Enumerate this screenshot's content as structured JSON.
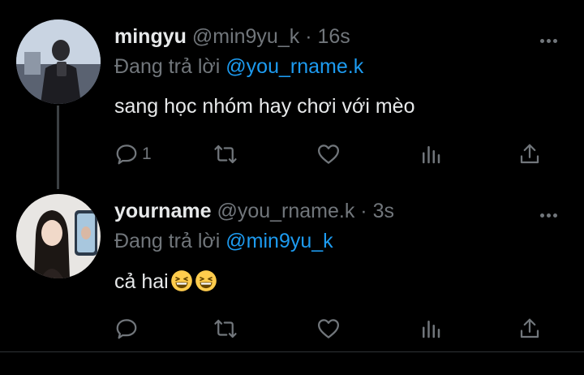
{
  "tweets": [
    {
      "name": "mingyu",
      "handle": "@min9yu_k",
      "time": "16s",
      "replying_prefix": "Đang trả lời",
      "replying_to": "@you_rname.k",
      "text": "sang học nhóm hay chơi với mèo",
      "reply_count": "1",
      "avatar": "man-mirror-selfie-photo"
    },
    {
      "name": "yourname",
      "handle": "@you_rname.k",
      "time": "3s",
      "replying_prefix": "Đang trả lời",
      "replying_to": "@min9yu_k",
      "text": "cả hai",
      "emoji": [
        "grinning-squinting-emoji",
        "grinning-squinting-emoji"
      ],
      "reply_count": "",
      "avatar": "woman-selfie-photo"
    }
  ],
  "icons": {
    "more": "more-dots-icon",
    "reply": "reply-bubble-icon",
    "retweet": "retweet-icon",
    "like": "heart-icon",
    "views": "views-chart-icon",
    "share": "share-icon"
  },
  "colors": {
    "background": "#000000",
    "text": "#e7e9ea",
    "muted": "#71767b",
    "link": "#1d9bf0"
  }
}
